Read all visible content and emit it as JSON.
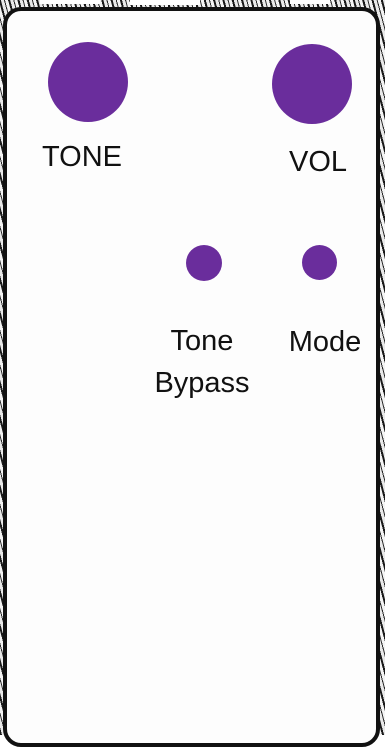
{
  "colors": {
    "knob": "#6a2d9c",
    "enclosure_border": "#111111",
    "enclosure_fill": "#fdfdfd"
  },
  "pedal": {
    "controls": [
      {
        "id": "tone",
        "label": "TONE",
        "kind": "knob"
      },
      {
        "id": "vol",
        "label": "VOL",
        "kind": "knob"
      },
      {
        "id": "tone_bypass",
        "label_line1": "Tone",
        "label_line2": "Bypass",
        "kind": "switch"
      },
      {
        "id": "mode",
        "label": "Mode",
        "kind": "switch"
      }
    ]
  }
}
